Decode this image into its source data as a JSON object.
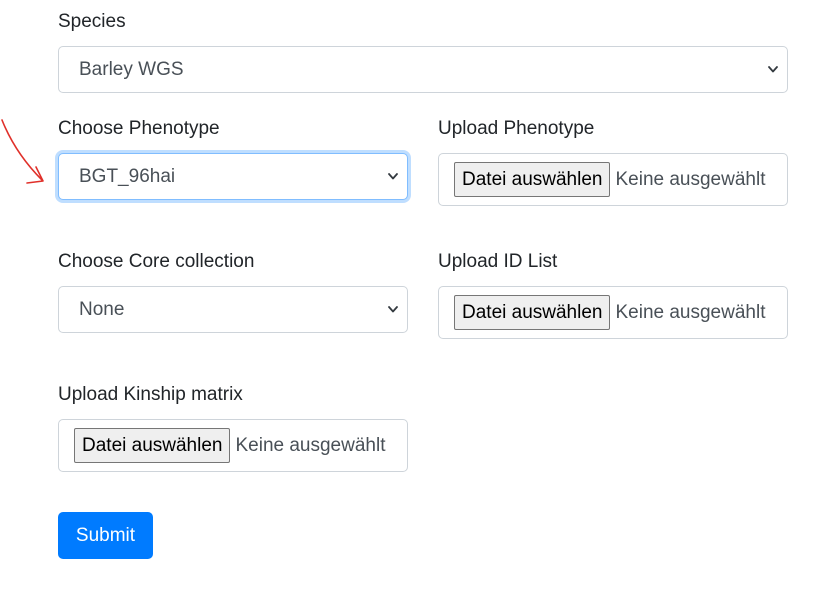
{
  "species": {
    "label": "Species",
    "selected": "Barley WGS"
  },
  "phenotype": {
    "label": "Choose Phenotype",
    "selected": "BGT_96hai"
  },
  "upload_phenotype": {
    "label": "Upload Phenotype",
    "button": "Datei auswählen",
    "status": "Keine ausgewählt"
  },
  "core_collection": {
    "label": "Choose Core collection",
    "selected": "None"
  },
  "upload_id_list": {
    "label": "Upload ID List",
    "button": "Datei auswählen",
    "status": "Keine ausgewählt"
  },
  "upload_kinship": {
    "label": "Upload Kinship matrix",
    "button": "Datei auswählen",
    "status": "Keine ausgewählt"
  },
  "submit": {
    "label": "Submit"
  },
  "colors": {
    "primary": "#007bff",
    "focus_border": "#80bdff",
    "annotation_arrow": "#e0302a"
  },
  "icons": {
    "select_chevron": "chevron-down-icon",
    "annotation": "hand-drawn-arrow-icon"
  }
}
